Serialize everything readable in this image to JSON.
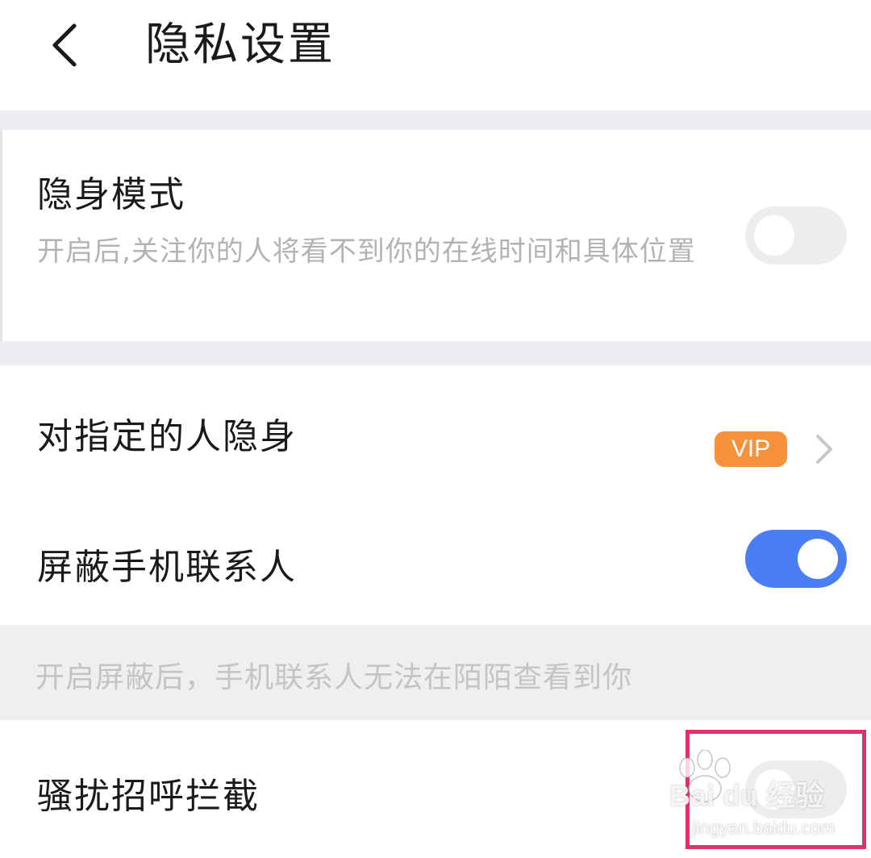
{
  "header": {
    "title": "隐私设置",
    "back_icon": "chevron-left-icon"
  },
  "settings": {
    "invisible_mode": {
      "title": "隐身模式",
      "description": "开启后,关注你的人将看不到你的在线时间和具体位置",
      "enabled": false
    },
    "hide_from_specific": {
      "title": "对指定的人隐身",
      "badge": "VIP",
      "arrow_icon": "chevron-right-icon"
    },
    "block_contacts": {
      "title": "屏蔽手机联系人",
      "enabled": true,
      "note": "开启屏蔽后，手机联系人无法在陌陌查看到你"
    },
    "block_harassment": {
      "title": "骚扰招呼拦截",
      "enabled": false
    }
  },
  "watermark": {
    "brand": "Bai du 经验",
    "url": "jingyan.baidu.com"
  },
  "colors": {
    "toggle_on": "#4a7ef5",
    "toggle_off": "#ededed",
    "vip_badge": "#f7923a",
    "section_gap": "#eeeef2",
    "highlight_border": "#e0306a"
  }
}
